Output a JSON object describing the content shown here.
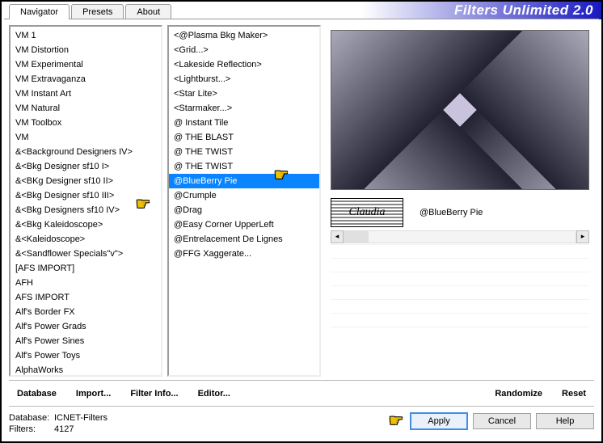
{
  "title": "Filters Unlimited 2.0",
  "tabs": [
    {
      "label": "Navigator",
      "active": true
    },
    {
      "label": "Presets",
      "active": false
    },
    {
      "label": "About",
      "active": false
    }
  ],
  "leftList": [
    "VM 1",
    "VM Distortion",
    "VM Experimental",
    "VM Extravaganza",
    "VM Instant Art",
    "VM Natural",
    "VM Toolbox",
    "VM",
    "&<Background Designers IV>",
    "&<Bkg Designer sf10 I>",
    "&<BKg Designer sf10 II>",
    "&<Bkg Designer sf10 III>",
    "&<Bkg Designers sf10 IV>",
    "&<Bkg Kaleidoscope>",
    "&<Kaleidoscope>",
    "&<Sandflower Specials\"v\">",
    "[AFS IMPORT]",
    "AFH",
    "AFS IMPORT",
    "Alf's Border FX",
    "Alf's Power Grads",
    "Alf's Power Sines",
    "Alf's Power Toys",
    "AlphaWorks"
  ],
  "leftSelectedIndex": 12,
  "midList": [
    "<@Plasma Bkg Maker>",
    "<Grid...>",
    "<Lakeside Reflection>",
    "<Lightburst...>",
    "<Star Lite>",
    "<Starmaker...>",
    "@ Instant Tile",
    "@ THE BLAST",
    "@ THE TWIST",
    "@ THE TWIST",
    "@BlueBerry Pie",
    "@Crumple",
    "@Drag",
    "@Easy Corner UpperLeft",
    "@Entrelacement De Lignes",
    "@FFG Xaggerate..."
  ],
  "midSelectedIndex": 10,
  "paramLabel": "@BlueBerry Pie",
  "watermark": "Claudia",
  "toolbar": {
    "database": "Database",
    "import": "Import...",
    "filterinfo": "Filter Info...",
    "editor": "Editor...",
    "randomize": "Randomize",
    "reset": "Reset"
  },
  "status": {
    "db_lbl": "Database:",
    "db_val": "ICNET-Filters",
    "fl_lbl": "Filters:",
    "fl_val": "4127"
  },
  "buttons": {
    "apply": "Apply",
    "cancel": "Cancel",
    "help": "Help"
  }
}
